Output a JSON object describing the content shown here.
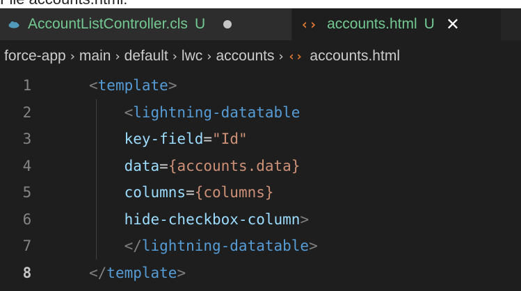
{
  "caption": {
    "text": "File accounts.html:"
  },
  "tabs": [
    {
      "label": "AccountListController.cls",
      "status": "U",
      "active": false,
      "dirty": true
    },
    {
      "label": "accounts.html",
      "status": "U",
      "active": true,
      "close": "✕"
    }
  ],
  "icons": {
    "salesforce_cloud": "salesforce-cloud-icon",
    "html_file": "‹›"
  },
  "colors": {
    "editor_bg": "#1e1e1e",
    "untracked_green": "#73c991",
    "html_icon_orange": "#e37933",
    "sf_cloud_blue": "#519aba"
  },
  "breadcrumb": {
    "segments": [
      "force-app",
      "main",
      "default",
      "lwc",
      "accounts",
      "accounts.html"
    ],
    "separator": "›"
  },
  "code": {
    "current_line": 8,
    "lines": [
      {
        "number": "1",
        "tokens": [
          {
            "t": "<",
            "c": "tag-bracket"
          },
          {
            "t": "template",
            "c": "tag-name"
          },
          {
            "t": ">",
            "c": "tag-bracket"
          }
        ]
      },
      {
        "number": "2",
        "tokens": [
          {
            "t": "    <",
            "c": "tag-bracket"
          },
          {
            "t": "lightning-datatable",
            "c": "tag-name"
          }
        ]
      },
      {
        "number": "3",
        "tokens": [
          {
            "t": "    key-field",
            "c": "attr-name"
          },
          {
            "t": "=",
            "c": "punct"
          },
          {
            "t": "\"Id\"",
            "c": "attr-string"
          }
        ]
      },
      {
        "number": "4",
        "tokens": [
          {
            "t": "    data",
            "c": "attr-name"
          },
          {
            "t": "=",
            "c": "punct"
          },
          {
            "t": "{accounts.data}",
            "c": "attr-string"
          }
        ]
      },
      {
        "number": "5",
        "tokens": [
          {
            "t": "    columns",
            "c": "attr-name"
          },
          {
            "t": "=",
            "c": "punct"
          },
          {
            "t": "{columns}",
            "c": "attr-string"
          }
        ]
      },
      {
        "number": "6",
        "tokens": [
          {
            "t": "    hide-checkbox-column",
            "c": "attr-name"
          },
          {
            "t": ">",
            "c": "tag-bracket"
          }
        ]
      },
      {
        "number": "7",
        "tokens": [
          {
            "t": "    </",
            "c": "tag-bracket"
          },
          {
            "t": "lightning-datatable",
            "c": "tag-name"
          },
          {
            "t": ">",
            "c": "tag-bracket"
          }
        ]
      },
      {
        "number": "8",
        "tokens": [
          {
            "t": "</",
            "c": "tag-bracket"
          },
          {
            "t": "template",
            "c": "tag-name"
          },
          {
            "t": ">",
            "c": "tag-bracket"
          }
        ]
      }
    ]
  }
}
